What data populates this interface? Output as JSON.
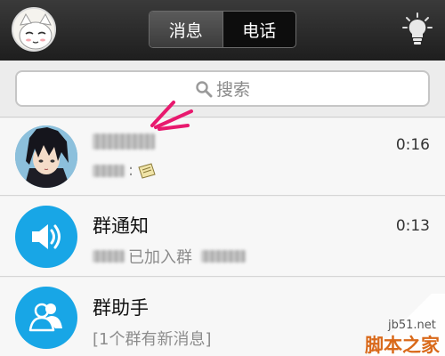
{
  "header": {
    "tabs": [
      {
        "label": "消息",
        "active": true
      },
      {
        "label": "电话",
        "active": false
      }
    ]
  },
  "search": {
    "placeholder": "搜索"
  },
  "conversations": [
    {
      "name": "",
      "time": "0:16",
      "preview_suffix": ":",
      "avatar_icon": "anime-character-avatar"
    },
    {
      "name": "群通知",
      "time": "0:13",
      "preview_text": "已加入群",
      "avatar_icon": "speaker-icon"
    },
    {
      "name": "群助手",
      "time": "",
      "preview_text": "[1个群有新消息]",
      "avatar_icon": "people-icon"
    }
  ],
  "watermark": {
    "site": "jb51.net",
    "brand": "脚本之家"
  },
  "colors": {
    "accent_blue": "#18a6e6",
    "highlight_orange": "#f08a22",
    "annotation_pink": "#e8196e"
  }
}
